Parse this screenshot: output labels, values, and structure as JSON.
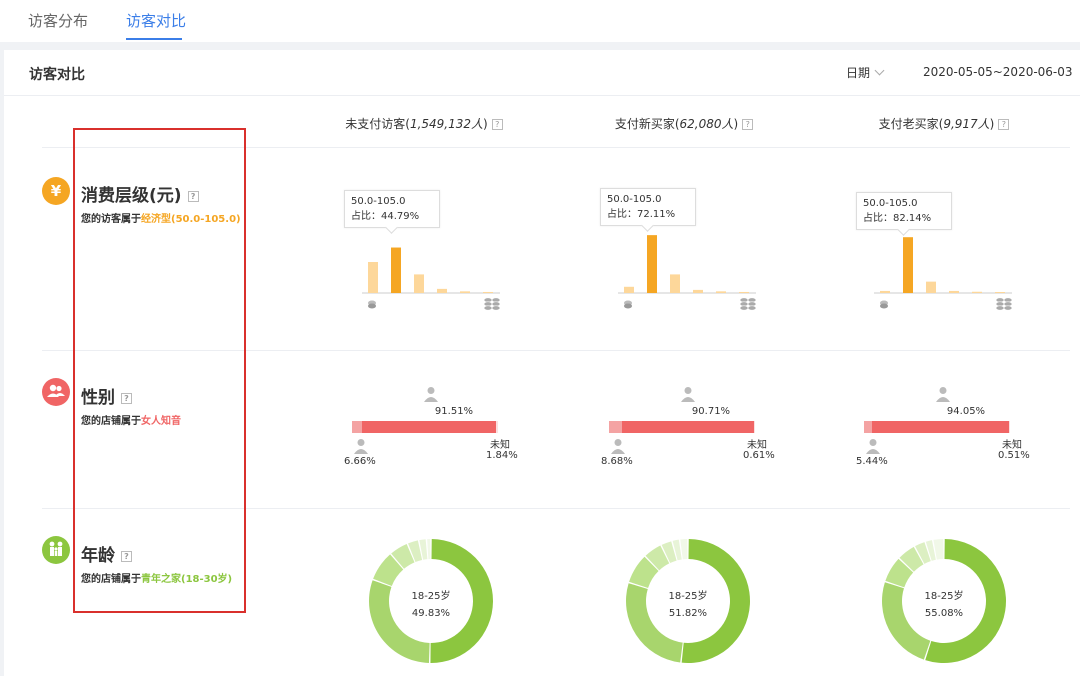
{
  "tabs": [
    {
      "label": "访客分布"
    },
    {
      "label": "访客对比"
    }
  ],
  "header": {
    "title": "访客对比",
    "date_label": "日期",
    "date_range": "2020-05-05~2020-06-03"
  },
  "columns": [
    {
      "label": "未支付访客(",
      "count": "1,549,132人",
      "close": ")"
    },
    {
      "label": "支付新买家(",
      "count": "62,080人",
      "close": ")"
    },
    {
      "label": "支付老买家(",
      "count": "9,917人",
      "close": ")"
    }
  ],
  "sections": {
    "consumption": {
      "title": "消费层级(元)",
      "icon": "yuan-icon",
      "icon_color": "#f5a623",
      "desc_prefix": "您的访客属于",
      "desc_highlight": "经济型(50.0-105.0)"
    },
    "gender": {
      "title": "性别",
      "icon": "people-icon",
      "icon_color": "#f06565",
      "desc_prefix": "您的店铺属于",
      "desc_highlight": "女人知音"
    },
    "age": {
      "title": "年龄",
      "icon": "family-icon",
      "icon_color": "#8cc63f",
      "desc_prefix": "您的店铺属于",
      "desc_highlight": "青年之家(18-30岁)"
    }
  },
  "consumption_tooltips": [
    {
      "range": "50.0-105.0",
      "share": "占比：44.79%"
    },
    {
      "range": "50.0-105.0",
      "share": "占比：72.11%"
    },
    {
      "range": "50.0-105.0",
      "share": "占比：82.14%"
    }
  ],
  "gender_stats": [
    {
      "female": "91.51%",
      "male": "6.66%",
      "unknown_label": "未知",
      "unknown": "1.84%"
    },
    {
      "female": "90.71%",
      "male": "8.68%",
      "unknown_label": "未知",
      "unknown": "0.61%"
    },
    {
      "female": "94.05%",
      "male": "5.44%",
      "unknown_label": "未知",
      "unknown": "0.51%"
    }
  ],
  "age_stats": [
    {
      "group": "18-25岁",
      "share": "49.83%"
    },
    {
      "group": "18-25岁",
      "share": "51.82%"
    },
    {
      "group": "18-25岁",
      "share": "55.08%"
    }
  ],
  "chart_data": [
    {
      "type": "bar",
      "series": [
        {
          "values": [
            15,
            22,
            9,
            2,
            0.8,
            0.5
          ],
          "highlight_index": 1
        }
      ],
      "ylim": [
        0,
        30
      ],
      "highlight_color": "#f5a623",
      "base_color": "#fdd79a"
    },
    {
      "type": "bar",
      "series": [
        {
          "values": [
            3,
            28,
            9,
            1.5,
            0.8,
            0.5
          ],
          "highlight_index": 1
        }
      ],
      "ylim": [
        0,
        30
      ],
      "highlight_color": "#f5a623",
      "base_color": "#fdd79a"
    },
    {
      "type": "bar",
      "series": [
        {
          "values": [
            1,
            27,
            5.5,
            1,
            0.6,
            0.4
          ],
          "highlight_index": 1
        }
      ],
      "ylim": [
        0,
        30
      ],
      "highlight_color": "#f5a623",
      "base_color": "#fdd79a"
    },
    {
      "type": "pie",
      "donut": true,
      "values": [
        49.83,
        30,
        8,
        5,
        3,
        2,
        1.17
      ],
      "colors": [
        "#8cc63f",
        "#a8d56d",
        "#bde28c",
        "#cde9a8",
        "#dcefc2",
        "#e8f4d8",
        "#f1f8e8"
      ]
    },
    {
      "type": "pie",
      "donut": true,
      "values": [
        51.82,
        28,
        8,
        5,
        3,
        2,
        2.18
      ],
      "colors": [
        "#8cc63f",
        "#a8d56d",
        "#bde28c",
        "#cde9a8",
        "#dcefc2",
        "#e8f4d8",
        "#f1f8e8"
      ]
    },
    {
      "type": "pie",
      "donut": true,
      "values": [
        55.08,
        25,
        7,
        5,
        3,
        2,
        2.92
      ],
      "colors": [
        "#8cc63f",
        "#a8d56d",
        "#bde28c",
        "#cde9a8",
        "#dcefc2",
        "#e8f4d8",
        "#f1f8e8"
      ]
    }
  ]
}
